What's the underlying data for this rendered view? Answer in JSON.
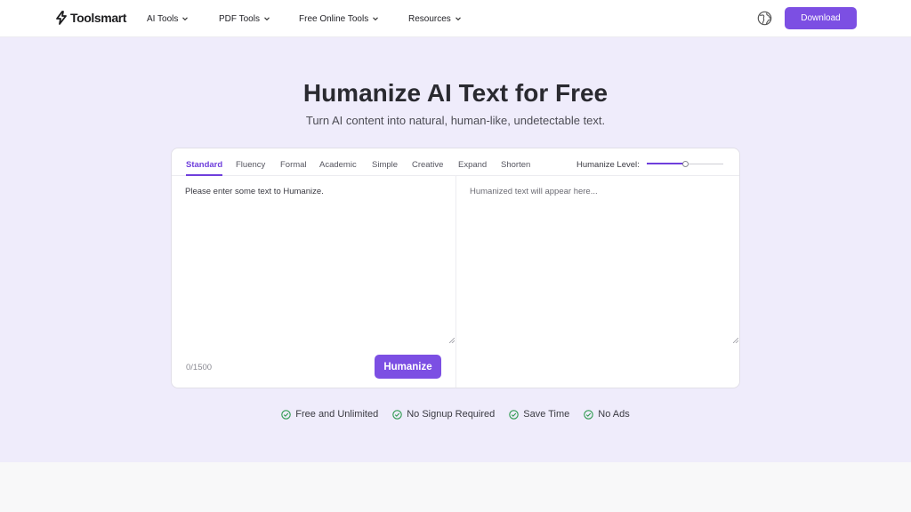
{
  "brand": {
    "name": "Toolsmart",
    "accent": "#7c4fe3"
  },
  "nav": {
    "items": [
      {
        "label": "AI Tools"
      },
      {
        "label": "PDF Tools"
      },
      {
        "label": "Free Online Tools"
      },
      {
        "label": "Resources"
      }
    ],
    "language_icon": "globe-icon",
    "download_label": "Download"
  },
  "hero": {
    "title": "Humanize AI Text for Free",
    "subtitle": "Turn AI content into natural, human-like, undetectable text."
  },
  "editor": {
    "modes": [
      "Standard",
      "Fluency",
      "Formal",
      "Academic",
      "Simple",
      "Creative",
      "Expand",
      "Shorten"
    ],
    "active_mode": "Standard",
    "level_label": "Humanize Level:",
    "level_fraction": 0.5,
    "input_placeholder": "Please enter some text to Humanize.",
    "input_value": "",
    "output_placeholder": "Humanized text will appear here...",
    "char_count": "0/1500",
    "humanize_label": "Humanize"
  },
  "features": [
    "Free and Unlimited",
    "No Signup Required",
    "Save Time",
    "No Ads"
  ]
}
